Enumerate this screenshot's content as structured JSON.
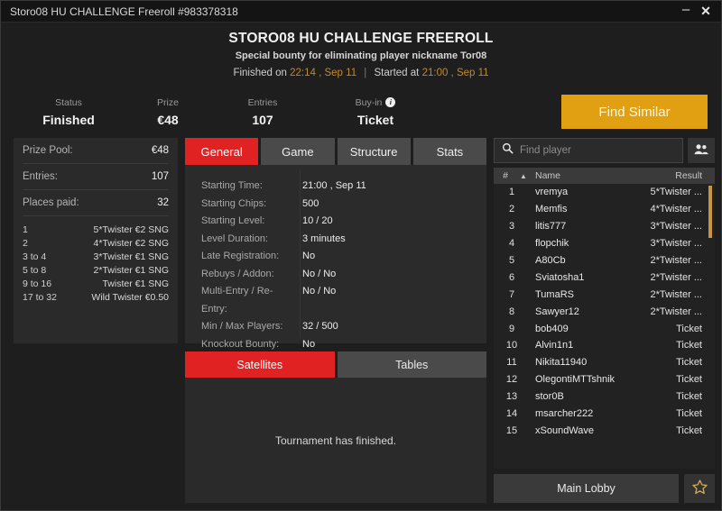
{
  "window": {
    "title": "Storo08 HU CHALLENGE Freeroll #983378318",
    "minimize_label": "–",
    "close_label": "✕"
  },
  "header": {
    "title": "STORO08 HU CHALLENGE FREEROLL",
    "subtitle": "Special bounty for eliminating player nickname Tor08",
    "finished_prefix": "Finished on",
    "finished_time": "22:14 , Sep 11",
    "divider": "|",
    "started_prefix": "Started at",
    "started_time": "21:00 , Sep 11"
  },
  "stats": {
    "status": {
      "label": "Status",
      "value": "Finished"
    },
    "prize": {
      "label": "Prize",
      "value": "€48"
    },
    "entries": {
      "label": "Entries",
      "value": "107"
    },
    "buyin": {
      "label": "Buy-in",
      "value": "Ticket",
      "info_glyph": "i"
    },
    "find_similar_label": "Find Similar"
  },
  "prize_panel": {
    "rows": [
      {
        "key": "Prize Pool:",
        "value": "€48"
      },
      {
        "key": "Entries:",
        "value": "107"
      },
      {
        "key": "Places paid:",
        "value": "32"
      }
    ],
    "payouts": [
      {
        "place": "1",
        "award": "5*Twister €2 SNG"
      },
      {
        "place": "2",
        "award": "4*Twister €2 SNG"
      },
      {
        "place": "3 to 4",
        "award": "3*Twister €1 SNG"
      },
      {
        "place": "5 to 8",
        "award": "2*Twister €1 SNG"
      },
      {
        "place": "9 to 16",
        "award": "Twister €1 SNG"
      },
      {
        "place": "17 to 32",
        "award": "Wild Twister €0.50"
      }
    ]
  },
  "satellites": {
    "tabs": [
      {
        "label": "Satellites",
        "active": true
      },
      {
        "label": "Tables",
        "active": false
      }
    ],
    "message": "Tournament has finished."
  },
  "info_tabs": {
    "tabs": [
      {
        "label": "General",
        "active": true
      },
      {
        "label": "Game",
        "active": false
      },
      {
        "label": "Structure",
        "active": false
      },
      {
        "label": "Stats",
        "active": false
      }
    ],
    "rows": [
      {
        "label": "Starting Time:",
        "value": "21:00 , Sep 11"
      },
      {
        "label": "Starting Chips:",
        "value": "500"
      },
      {
        "label": "Starting Level:",
        "value": "10 / 20"
      },
      {
        "label": "Level Duration:",
        "value": "3 minutes"
      },
      {
        "label": "Late Registration:",
        "value": "No"
      },
      {
        "label": "Rebuys / Addon:",
        "value": "No / No"
      },
      {
        "label": "Multi-Entry / Re-Entry:",
        "value": "No / No"
      },
      {
        "label": "Min / Max Players:",
        "value": "32 / 500"
      },
      {
        "label": "Knockout Bounty:",
        "value": "No"
      }
    ]
  },
  "players": {
    "search_placeholder": "Find player",
    "search_value": "",
    "columns": {
      "num": "#",
      "sort": "▲",
      "name": "Name",
      "result": "Result"
    },
    "rows": [
      {
        "num": "1",
        "name": "vremya",
        "result": "5*Twister ..."
      },
      {
        "num": "2",
        "name": "Memfis",
        "result": "4*Twister ..."
      },
      {
        "num": "3",
        "name": "litis777",
        "result": "3*Twister ..."
      },
      {
        "num": "4",
        "name": "flopchik",
        "result": "3*Twister ..."
      },
      {
        "num": "5",
        "name": "A80Cb",
        "result": "2*Twister ..."
      },
      {
        "num": "6",
        "name": "Sviatosha1",
        "result": "2*Twister ..."
      },
      {
        "num": "7",
        "name": "TumaRS",
        "result": "2*Twister ..."
      },
      {
        "num": "8",
        "name": "Sawyer12",
        "result": "2*Twister ..."
      },
      {
        "num": "9",
        "name": "bob409",
        "result": "Ticket"
      },
      {
        "num": "10",
        "name": "Alvin1n1",
        "result": "Ticket"
      },
      {
        "num": "11",
        "name": "Nikita11940",
        "result": "Ticket"
      },
      {
        "num": "12",
        "name": "OlegontiMTTshnik",
        "result": "Ticket"
      },
      {
        "num": "13",
        "name": "stor0B",
        "result": "Ticket"
      },
      {
        "num": "14",
        "name": "msarcher222",
        "result": "Ticket"
      },
      {
        "num": "15",
        "name": "xSoundWave",
        "result": "Ticket"
      }
    ],
    "main_lobby_label": "Main Lobby"
  },
  "colors": {
    "accent_red": "#e02222",
    "accent_gold": "#e0a012",
    "time_gold": "#c08a2e",
    "panel_bg": "#2a2a2a",
    "window_bg": "#1e1e1e"
  }
}
